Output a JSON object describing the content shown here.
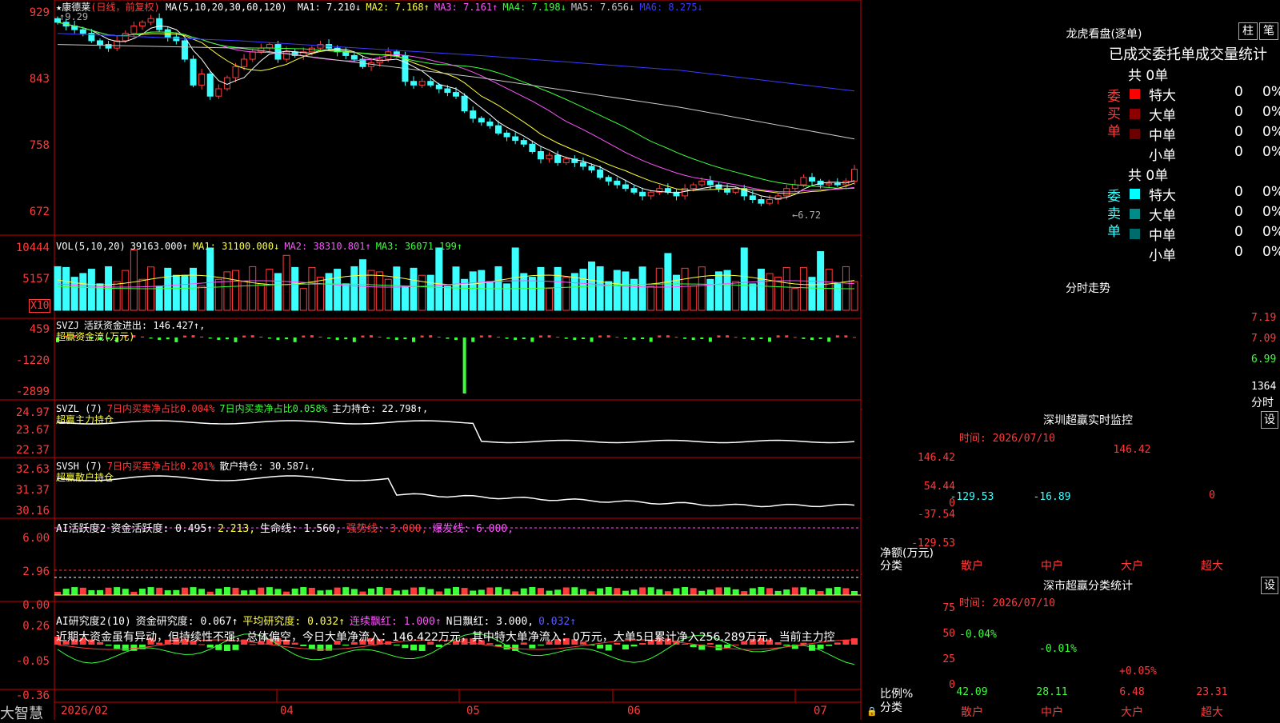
{
  "stock": {
    "name": "康德莱",
    "period": "(日线，前复权)"
  },
  "main": {
    "ma_prefix": "MA(5,10,20,30,60,120)",
    "ma": [
      {
        "label": "MA1:",
        "value": "7.210↓",
        "color": "#ffffff"
      },
      {
        "label": "MA2:",
        "value": "7.168↑",
        "color": "#ffff3b"
      },
      {
        "label": "MA3:",
        "value": "7.161↑",
        "color": "#ff55ff"
      },
      {
        "label": "MA4:",
        "value": "7.198↓",
        "color": "#3bff3b"
      },
      {
        "label": "MA5:",
        "value": "7.656↓",
        "color": "#cccccc"
      },
      {
        "label": "MA6:",
        "value": "8.275↓",
        "color": "#3b3bff"
      }
    ],
    "yticks": [
      "929",
      "843",
      "758",
      "672"
    ],
    "high_label": "9.29",
    "low_label": "←6.72"
  },
  "vol": {
    "title": "VOL(5,10,20)",
    "value": "39163.000↑",
    "ma1": "MA1: 31100.000↓",
    "ma2": "MA2: 38310.801↑",
    "ma3": "MA3: 36071.199↑",
    "yticks": [
      "10444",
      "5157"
    ],
    "unit": "X10"
  },
  "svzj": {
    "title": "SVZJ",
    "label": "活跃资金进出: 146.427↑,",
    "sub": "超赢资金流(万元)",
    "yticks": [
      "459",
      "-1220",
      "-2899"
    ]
  },
  "svzl": {
    "title": "SVZL (7)",
    "a": "7日内买卖净占比0.004%",
    "b": "7日内买卖净占比0.058%",
    "c": "主力持仓: 22.798↑,",
    "sub": "超赢主力持仓",
    "yticks": [
      "24.97",
      "23.67",
      "22.37"
    ]
  },
  "svsh": {
    "title": "SVSH (7)",
    "a": "7日内买卖净占比0.201%",
    "c": "散户持仓: 30.587↓,",
    "sub": "超赢散户持仓",
    "yticks": [
      "32.63",
      "31.37",
      "30.16"
    ]
  },
  "ai1": {
    "title": "AI活跃度2",
    "a": "资金活跃度: 0.495↑",
    "b": "2.213,",
    "c": "生命线: 1.560,",
    "d": "强势线: 3.000,",
    "e": "爆发线: 6.000,",
    "yticks": [
      "6.00",
      "2.96",
      "0.00"
    ]
  },
  "ai2": {
    "title": "AI研究度2(10)",
    "a": "资金研究度: 0.067↑",
    "b": "平均研究度: 0.032↑",
    "c": "连续飘红: 1.000↑",
    "d": "N日飘红: 3.000,",
    "e": "0.032↑",
    "comment": "近期大资金虽有异动，但持续性不强，总体偏空，今日大单净流入：146.422万元，其中特大单净流入：0万元，大单5日累计净入256.289万元，当前主力控",
    "yticks": [
      "0.26",
      "-0.05",
      "-0.36"
    ]
  },
  "xaxis": {
    "labels": [
      "2026/02",
      "04",
      "05",
      "06",
      "07"
    ]
  },
  "brand": "大智慧",
  "right": {
    "lhb_title": "龙虎看盘(逐单)",
    "btn_zhu": "柱",
    "btn_bi": "笔",
    "tabs_line": "已成交委托单成交量统计",
    "buy_side": "委买单",
    "sell_side": "委卖单",
    "buy_total": "共 0单",
    "sell_total": "共 0单",
    "buy_rows": [
      {
        "name": "特大",
        "n": "0",
        "p": "0%",
        "color": "#ff0000"
      },
      {
        "name": "大单",
        "n": "0",
        "p": "0%",
        "color": "#8b0000"
      },
      {
        "name": "中单",
        "n": "0",
        "p": "0%",
        "color": "#6b0000"
      },
      {
        "name": "小单",
        "n": "0",
        "p": "0%",
        "color": ""
      }
    ],
    "sell_rows": [
      {
        "name": "特大",
        "n": "0",
        "p": "0%",
        "color": "#00ffff"
      },
      {
        "name": "大单",
        "n": "0",
        "p": "0%",
        "color": "#008b8b"
      },
      {
        "name": "中单",
        "n": "0",
        "p": "0%",
        "color": "#006b6b"
      },
      {
        "name": "小单",
        "n": "0",
        "p": "0%",
        "color": ""
      }
    ],
    "fs_title": "分时走势",
    "fs_yticks": [
      "7.19",
      "7.09",
      "6.99"
    ],
    "fs_vol": "1364",
    "fs_unit": "分时",
    "sz_title": "深圳超赢实时监控",
    "sz_time": "时间: 2026/07/10",
    "sz_btn": "设",
    "sz_yticks": [
      "146.42",
      "54.44",
      "0",
      "-37.54",
      "-129.53"
    ],
    "sz_ylabel": "净额(万元)",
    "sz_xlabel": "分类",
    "sz_bars": [
      {
        "label": "散户",
        "value": -129.53,
        "text": "-129.53",
        "color": "#00ffff"
      },
      {
        "label": "中户",
        "value": -16.89,
        "text": "-16.89",
        "color": "#00ffff"
      },
      {
        "label": "大户",
        "value": 146.42,
        "text": "146.42",
        "color": "#ffffff"
      },
      {
        "label": "超大",
        "value": 0,
        "text": "0",
        "color": "#ffffff"
      }
    ],
    "fl_title": "深市超赢分类统计",
    "fl_time": "时间: 2026/07/10",
    "fl_btn": "设",
    "fl_yticks": [
      "75",
      "50",
      "25",
      "0"
    ],
    "fl_ylabel": "比例%",
    "fl_xlabel": "分类",
    "fl_bars": [
      {
        "label": "散户",
        "value": 42.09,
        "text": "42.09",
        "chg": "-0.04%",
        "color": "#22dd22",
        "chgcolor": "#3bff3b"
      },
      {
        "label": "中户",
        "value": 28.11,
        "text": "28.11",
        "chg": "-0.01%",
        "color": "#2222ff",
        "chgcolor": "#3bff3b"
      },
      {
        "label": "大户",
        "value": 6.48,
        "text": "6.48",
        "chg": "+0.05%",
        "color": "#00ffff",
        "chgcolor": "#ff3b3b"
      },
      {
        "label": "超大",
        "value": 23.31,
        "text": "23.31",
        "chg": "",
        "color": "#ff2222",
        "chgcolor": "#ff3b3b"
      }
    ]
  },
  "chart_data": {
    "type": "candlestick",
    "title": "康德莱 (日线，前复权)",
    "x_start": "2026/02",
    "x_month_labels": [
      "2026/02",
      "04",
      "05",
      "06",
      "07"
    ],
    "ohlc_note": "daily candles, values in yuan",
    "close": [
      9.2,
      9.15,
      9.1,
      9.05,
      8.95,
      8.9,
      8.85,
      8.95,
      9.05,
      9.15,
      9.2,
      9.25,
      9.1,
      9.0,
      8.95,
      8.7,
      8.35,
      8.5,
      8.2,
      8.3,
      8.45,
      8.6,
      8.7,
      8.8,
      8.85,
      8.9,
      8.7,
      8.8,
      8.75,
      8.8,
      8.85,
      8.9,
      8.85,
      8.8,
      8.75,
      8.7,
      8.6,
      8.65,
      8.7,
      8.8,
      8.75,
      8.4,
      8.35,
      8.4,
      8.35,
      8.3,
      8.25,
      8.2,
      8.0,
      7.9,
      7.85,
      7.8,
      7.7,
      7.65,
      7.6,
      7.55,
      7.45,
      7.35,
      7.4,
      7.3,
      7.35,
      7.3,
      7.25,
      7.2,
      7.1,
      7.05,
      7.0,
      6.95,
      6.9,
      6.85,
      6.9,
      6.95,
      6.9,
      6.85,
      6.95,
      7.0,
      7.05,
      7.0,
      6.95,
      6.9,
      6.95,
      6.85,
      6.8,
      6.75,
      6.8,
      6.85,
      6.95,
      7.0,
      7.1,
      7.05,
      7.0,
      7.02,
      7.0,
      7.05,
      7.21
    ],
    "ylim": [
      6.6,
      9.35
    ],
    "y_ticks": [
      9.29,
      8.43,
      7.58,
      6.72
    ],
    "high": 9.29,
    "low": 6.72
  }
}
